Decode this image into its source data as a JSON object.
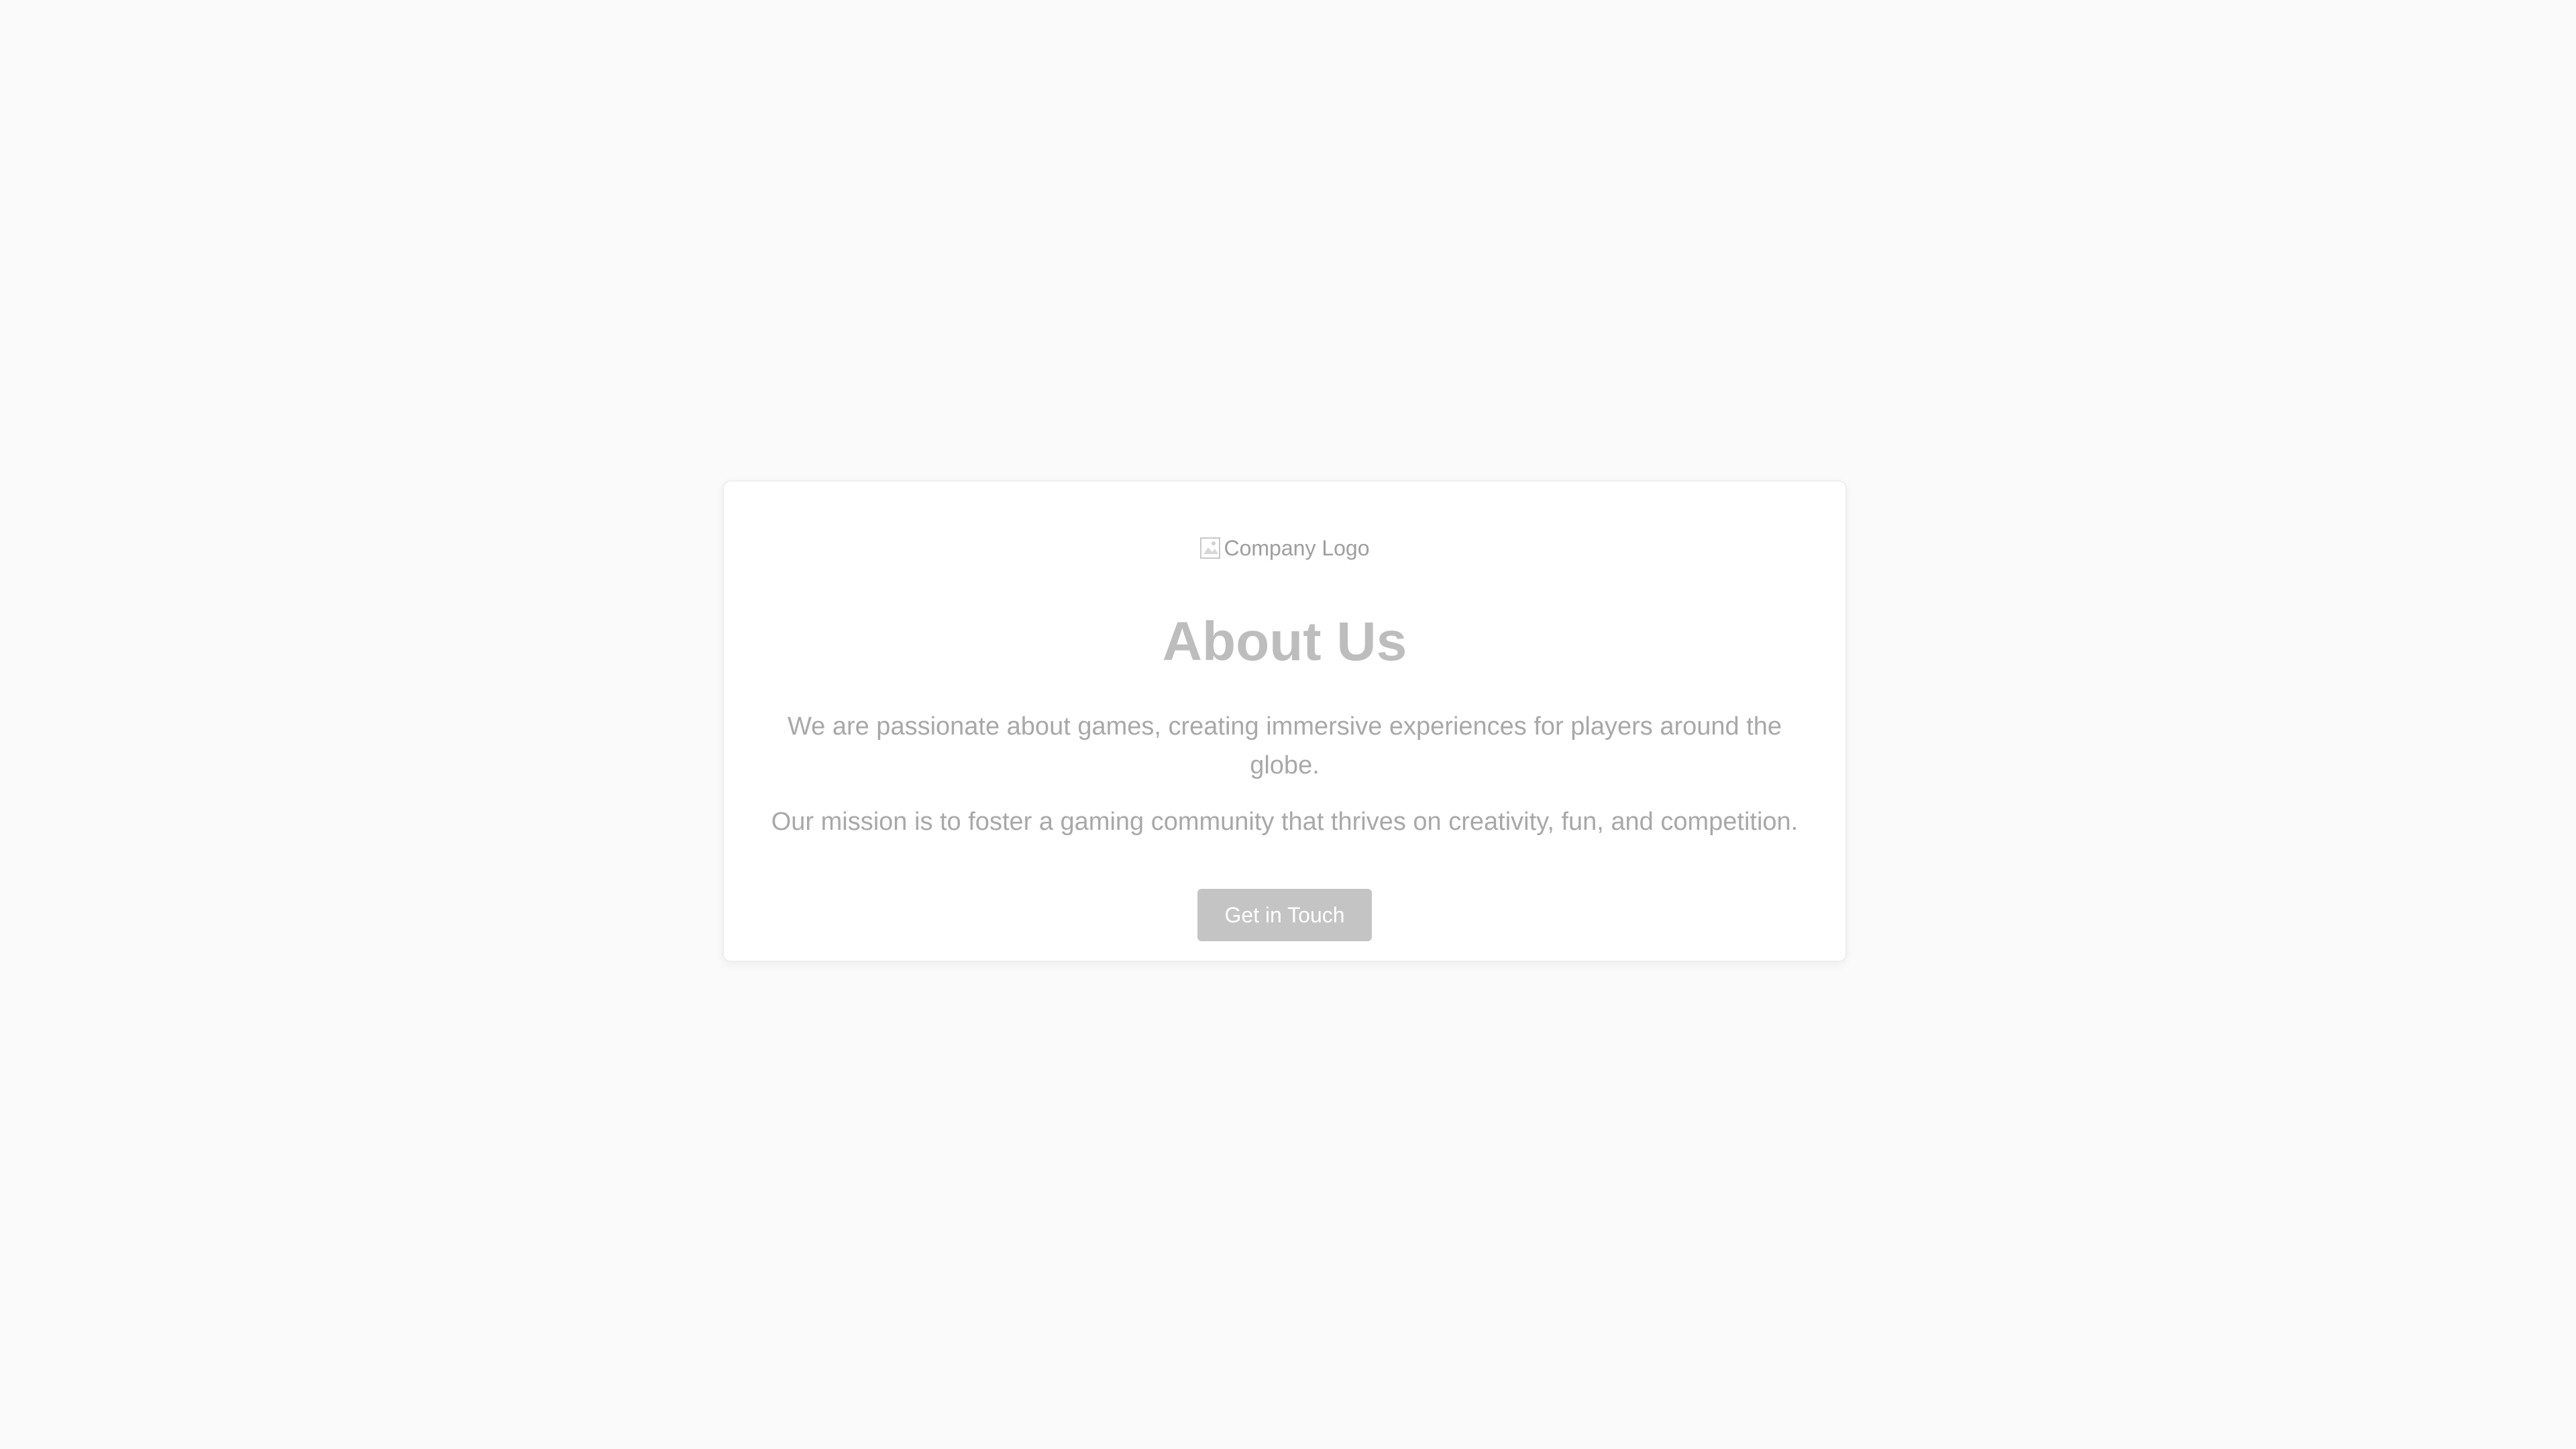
{
  "about": {
    "logo_alt": "Company Logo",
    "logo_icon": "broken-image-icon",
    "title": "About Us",
    "paragraph_1": "We are passionate about games, creating immersive experiences for players around the globe.",
    "paragraph_2": "Our mission is to foster a gaming community that thrives on creativity, fun, and competition.",
    "cta_label": "Get in Touch"
  },
  "colors": {
    "background": "#fafafa",
    "card": "#ffffff",
    "heading": "#bdbdbd",
    "text": "#a8a8a8",
    "button": "#c4c4c4"
  }
}
